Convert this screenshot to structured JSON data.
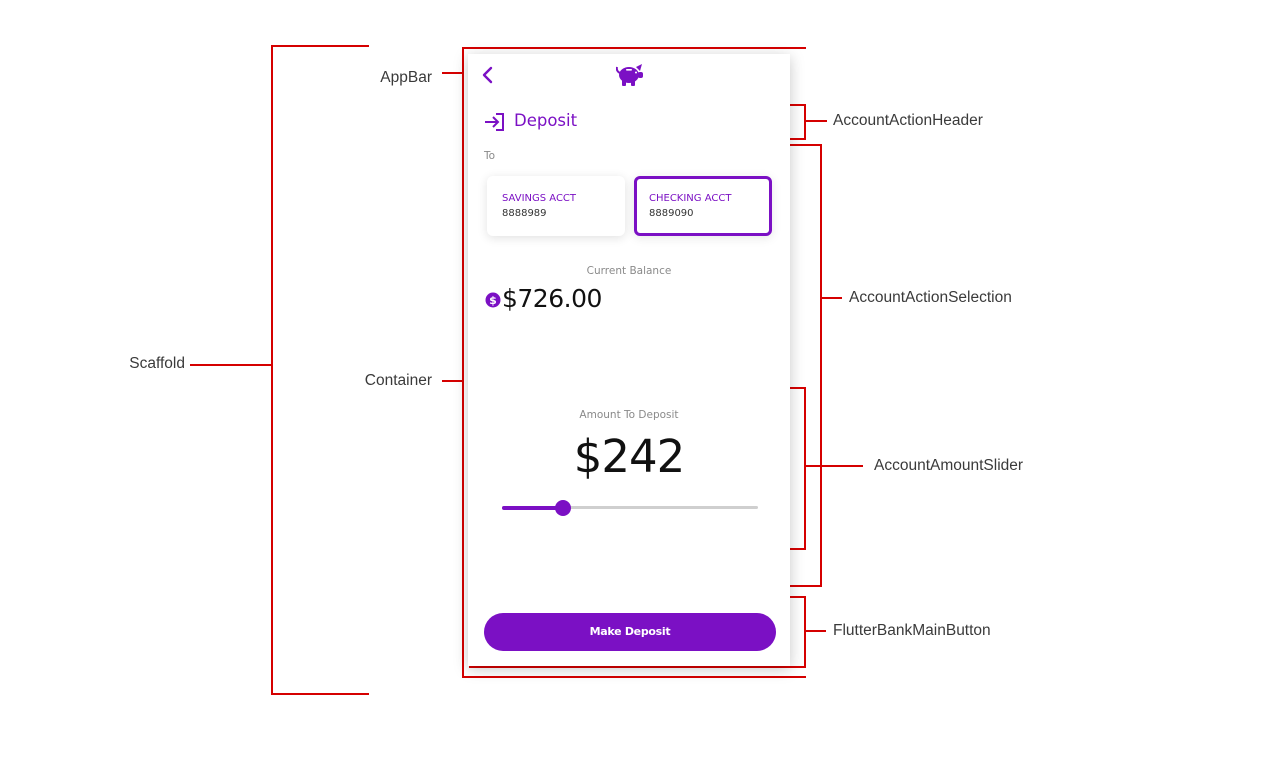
{
  "annotations": {
    "scaffold": "Scaffold",
    "appbar": "AppBar",
    "container": "Container",
    "account_action_header": "AccountActionHeader",
    "account_action_selection": "AccountActionSelection",
    "account_amount_slider": "AccountAmountSlider",
    "main_button": "FlutterBankMainButton"
  },
  "colors": {
    "accent": "#7b10c4",
    "annotation_line": "#d50000"
  },
  "icons": {
    "back": "chevron-left-icon",
    "logo": "piggy-bank-icon",
    "header": "login-arrow-icon",
    "balance": "dollar-circle-icon"
  },
  "app": {
    "header": {
      "title": "Deposit"
    },
    "selection": {
      "to_label": "To",
      "accounts": [
        {
          "type": "SAVINGS ACCT",
          "number": "8888989",
          "selected": false
        },
        {
          "type": "CHECKING ACCT",
          "number": "8889090",
          "selected": true
        }
      ],
      "current_balance_label": "Current Balance",
      "current_balance": "$726.00"
    },
    "slider": {
      "label": "Amount To Deposit",
      "value_text": "$242",
      "value_fraction": 0.24
    },
    "button": {
      "label": "Make Deposit"
    }
  }
}
